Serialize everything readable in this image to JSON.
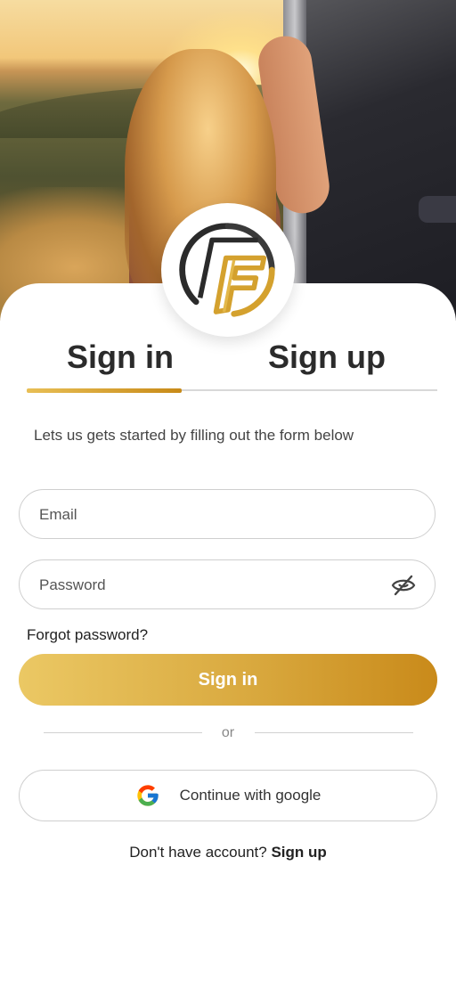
{
  "hero": {
    "image": "woman-at-car-sunset-photo"
  },
  "logo": {
    "icon": "brand-f-logo",
    "colors": {
      "dark": "#2b2b2b",
      "gold": "#d4a12e"
    }
  },
  "tabs": [
    {
      "label": "Sign in",
      "active": true
    },
    {
      "label": "Sign up",
      "active": false
    }
  ],
  "subtitle": "Lets us gets started by filling out the form below",
  "form": {
    "email": {
      "placeholder": "Email",
      "value": ""
    },
    "password": {
      "placeholder": "Password",
      "value": "",
      "toggle_icon": "eye-off-icon"
    },
    "forgot_label": "Forgot password?",
    "submit_label": "Sign in"
  },
  "divider": {
    "label": "or"
  },
  "google": {
    "label": "Continue with google",
    "icon": "google-icon"
  },
  "footer": {
    "prompt": "Don't have account?",
    "link": "Sign up"
  },
  "colors": {
    "accent_start": "#ebc864",
    "accent_end": "#c98a1a",
    "border": "#cfcfcf"
  }
}
